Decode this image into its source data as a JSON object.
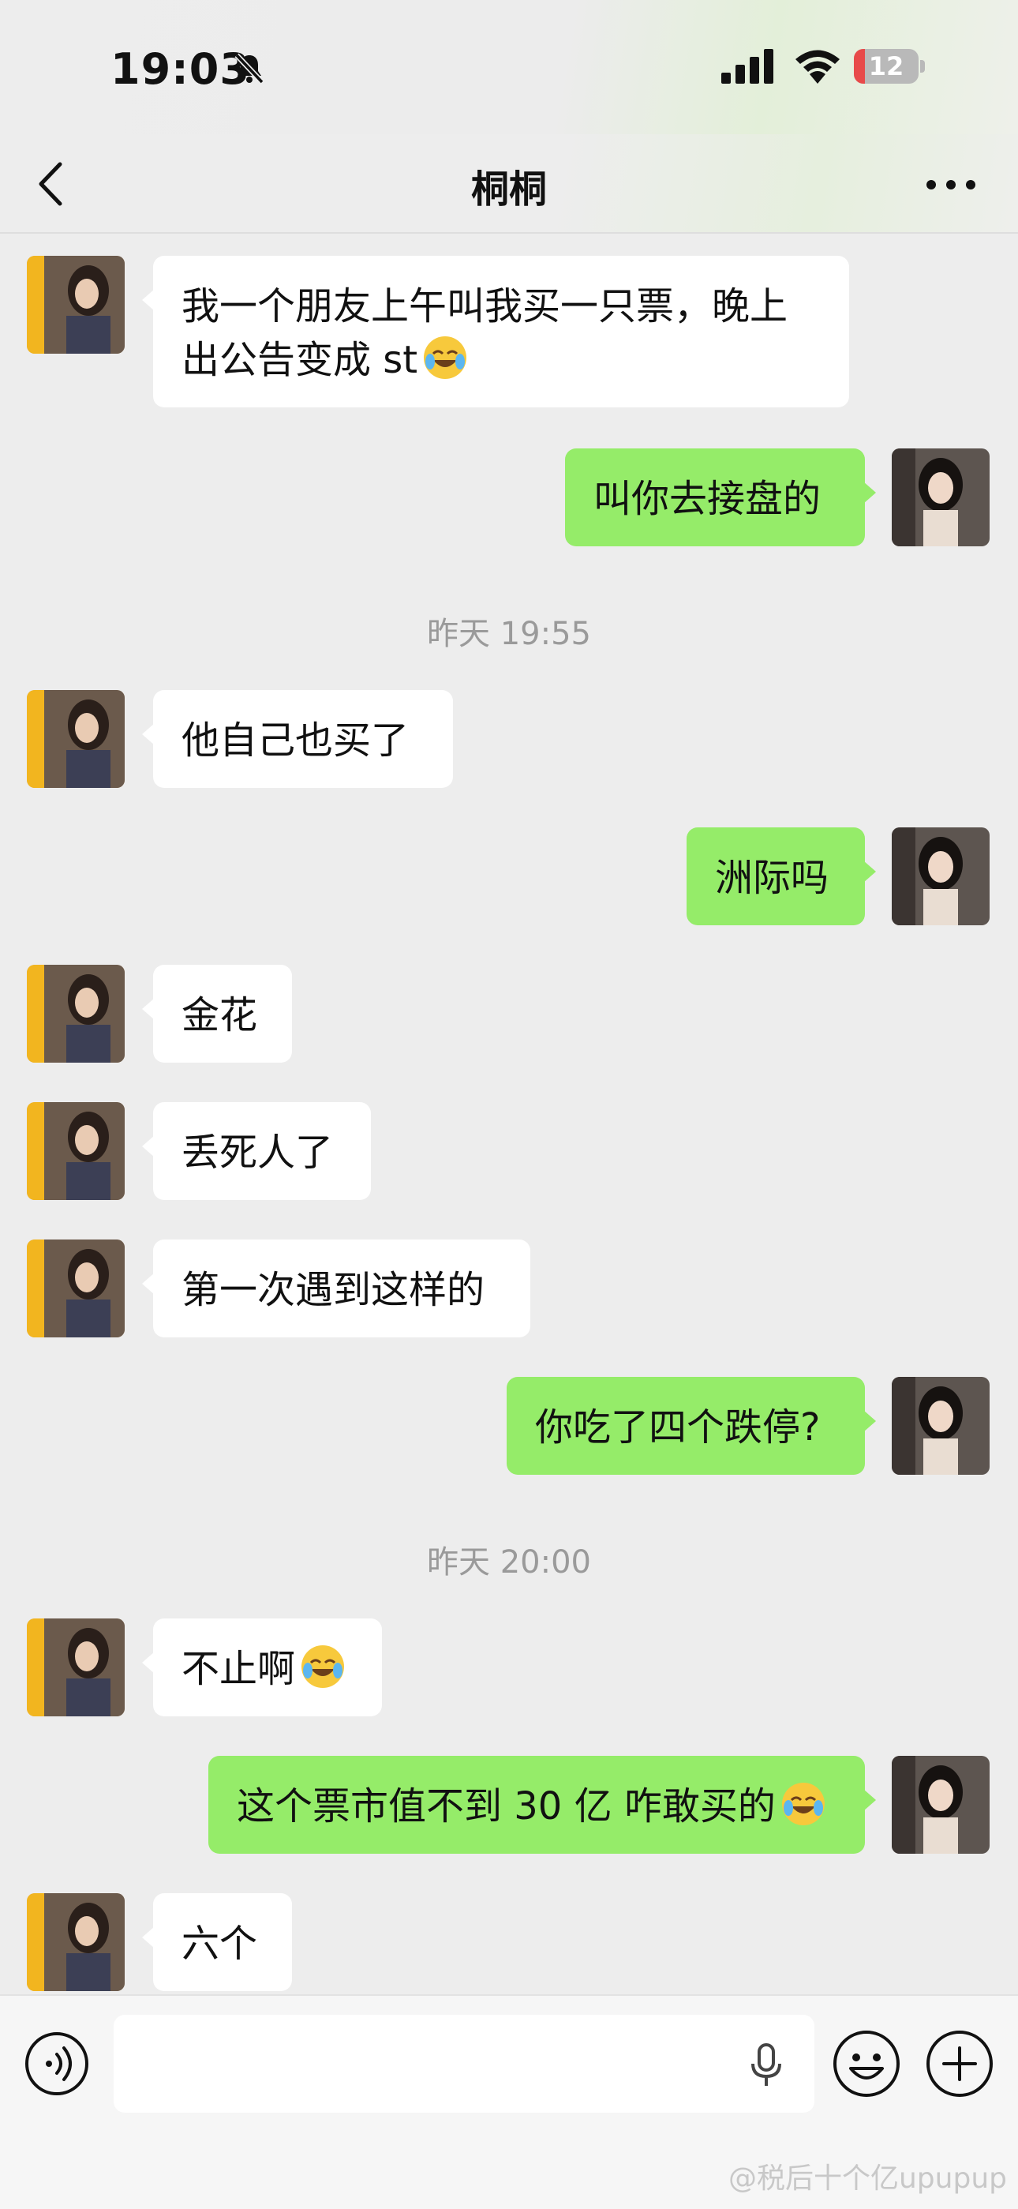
{
  "status": {
    "time": "19:03",
    "battery": "12"
  },
  "header": {
    "title": "桐桐"
  },
  "messages": [
    {
      "text": "我一个朋友上午叫我买一只票，晚上",
      "text2": "出公告变成 st"
    },
    {
      "text": "叫你去接盘的"
    },
    {
      "text": "他自己也买了"
    },
    {
      "text": "洲际吗"
    },
    {
      "text": "金花"
    },
    {
      "text": "丢死人了"
    },
    {
      "text": "第一次遇到这样的"
    },
    {
      "text": "你吃了四个跌停?"
    },
    {
      "text": "不止啊"
    },
    {
      "text": "这个票市值不到 30 亿 咋敢买的"
    },
    {
      "text": "六个"
    }
  ],
  "timestamps": [
    "昨天 19:55",
    "昨天 20:00"
  ],
  "colors": {
    "outgoing_bubble": "#95ec69",
    "incoming_bubble": "#ffffff",
    "background": "#ededed"
  },
  "icons": [
    "back-icon",
    "more-icon",
    "bell-off-icon",
    "signal-icon",
    "wifi-icon",
    "battery-icon",
    "voice-icon",
    "mic-icon",
    "emoji-icon",
    "plus-icon",
    "laughing-crying-emoji"
  ],
  "watermark": "@税后十个亿upupup"
}
